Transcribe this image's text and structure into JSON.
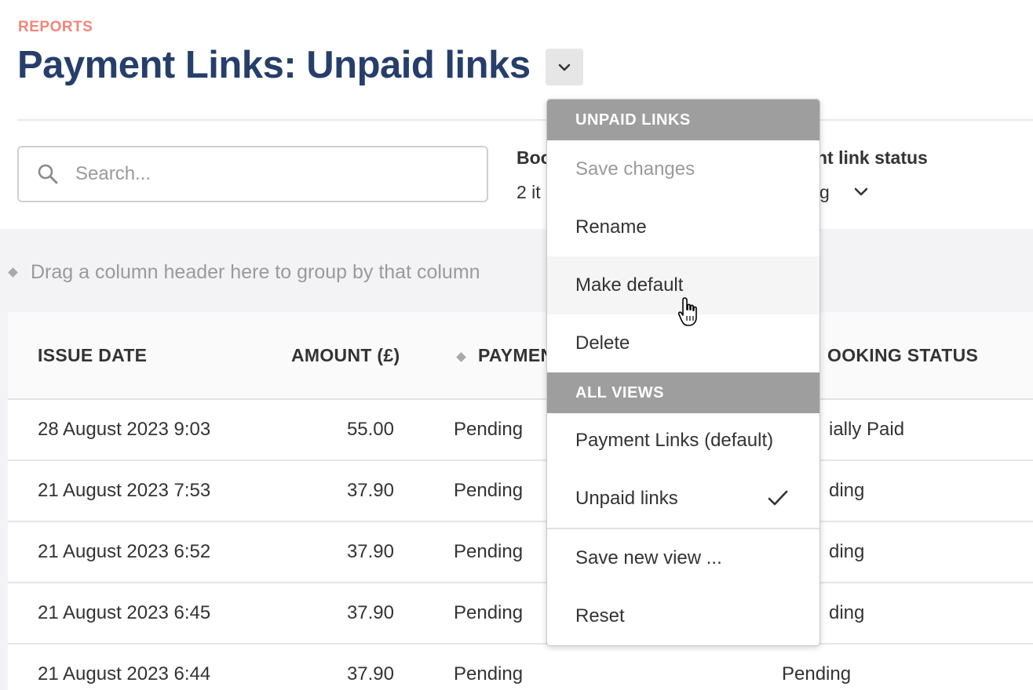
{
  "header": {
    "eyebrow": "REPORTS",
    "title": "Payment Links: Unpaid links"
  },
  "search": {
    "placeholder": "Search..."
  },
  "filters": [
    {
      "label_visible": "Boo",
      "value_visible": "2 it"
    },
    {
      "label_visible": "nt link status",
      "value_visible": "g"
    }
  ],
  "group_hint": "Drag a column header here to group by that column",
  "table": {
    "columns": [
      "ISSUE DATE",
      "AMOUNT (£)",
      "PAYMEN",
      "OOKING STATUS"
    ],
    "rows": [
      {
        "issue_date": "28 August 2023 9:03",
        "amount": "55.00",
        "payment": "Pending",
        "booking": "ially Paid"
      },
      {
        "issue_date": "21 August 2023 7:53",
        "amount": "37.90",
        "payment": "Pending",
        "booking": "ding"
      },
      {
        "issue_date": "21 August 2023 6:52",
        "amount": "37.90",
        "payment": "Pending",
        "booking": "ding"
      },
      {
        "issue_date": "21 August 2023 6:45",
        "amount": "37.90",
        "payment": "Pending",
        "booking": "ding"
      },
      {
        "issue_date": "21 August 2023 6:44",
        "amount": "37.90",
        "payment": "Pending",
        "booking": "Pending"
      }
    ]
  },
  "menu": {
    "section1_header": "UNPAID LINKS",
    "save_changes": "Save changes",
    "rename": "Rename",
    "make_default": "Make default",
    "delete": "Delete",
    "section2_header": "ALL VIEWS",
    "view_default": "Payment Links (default)",
    "view_unpaid": "Unpaid links",
    "save_new_view": "Save new view ...",
    "reset": "Reset"
  },
  "colors": {
    "eyebrow": "#f0867a",
    "title": "#263e6a",
    "menu_header_bg": "#9e9e9e"
  }
}
